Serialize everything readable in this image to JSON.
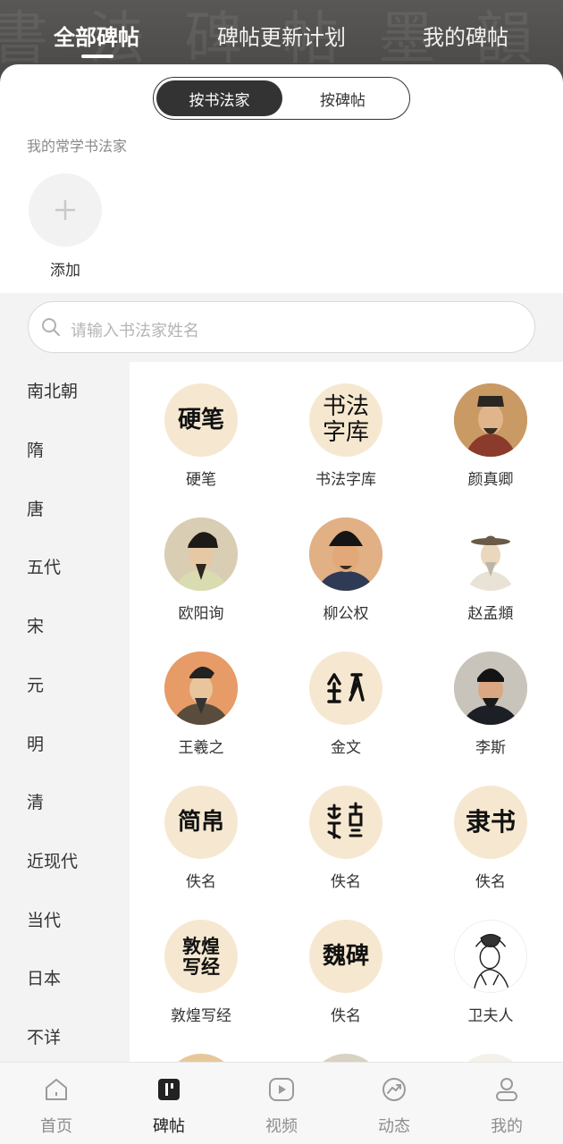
{
  "header": {
    "tabs": [
      {
        "label": "全部碑帖",
        "active": true
      },
      {
        "label": "碑帖更新计划",
        "active": false
      },
      {
        "label": "我的碑帖",
        "active": false
      }
    ]
  },
  "segment": {
    "options": [
      "按书法家",
      "按碑帖"
    ],
    "selected": "按书法家"
  },
  "favorites": {
    "title": "我的常学书法家",
    "add_label": "添加"
  },
  "search": {
    "placeholder": "请输入书法家姓名"
  },
  "dynasties": [
    "南北朝",
    "隋",
    "唐",
    "五代",
    "宋",
    "元",
    "明",
    "清",
    "近现代",
    "当代",
    "日本",
    "不详"
  ],
  "calligraphers": [
    {
      "name": "硬笔",
      "avatar_text": "硬笔"
    },
    {
      "name": "书法字库",
      "avatar_text": "书法字库"
    },
    {
      "name": "颜真卿",
      "avatar_icon": "portrait-icon"
    },
    {
      "name": "欧阳询",
      "avatar_icon": "portrait-icon"
    },
    {
      "name": "柳公权",
      "avatar_icon": "portrait-icon"
    },
    {
      "name": "赵孟頫",
      "avatar_icon": "portrait-icon"
    },
    {
      "name": "王羲之",
      "avatar_icon": "portrait-icon"
    },
    {
      "name": "金文",
      "avatar_icon": "bronze-script-icon"
    },
    {
      "name": "李斯",
      "avatar_icon": "portrait-icon"
    },
    {
      "name": "佚名",
      "avatar_text": "简帛"
    },
    {
      "name": "佚名",
      "avatar_icon": "seal-script-icon"
    },
    {
      "name": "佚名",
      "avatar_text": "隶书"
    },
    {
      "name": "敦煌写经",
      "avatar_text": "敦煌写经"
    },
    {
      "name": "佚名",
      "avatar_text": "魏碑"
    },
    {
      "name": "卫夫人",
      "avatar_icon": "portrait-icon"
    }
  ],
  "bottom_nav": [
    {
      "label": "首页",
      "icon": "home-icon",
      "active": false
    },
    {
      "label": "碑帖",
      "icon": "rubbing-icon",
      "active": true
    },
    {
      "label": "视频",
      "icon": "play-icon",
      "active": false
    },
    {
      "label": "动态",
      "icon": "trend-icon",
      "active": false
    },
    {
      "label": "我的",
      "icon": "user-icon",
      "active": false
    }
  ],
  "colors": {
    "header_bg": "#4e4c4a",
    "accent_dark": "#333333",
    "avatar_cream": "#f6e8d0"
  }
}
